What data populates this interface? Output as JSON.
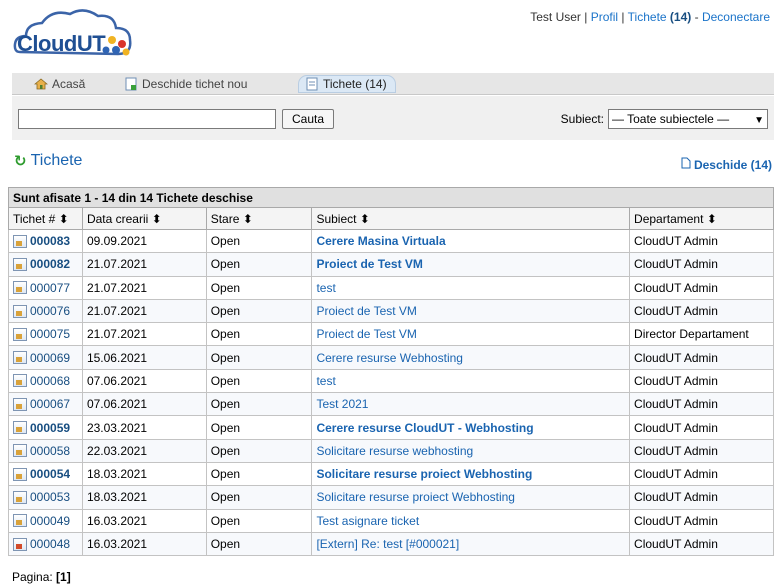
{
  "header": {
    "logo_text": "CloudUT",
    "user": "Test User",
    "profile_link": "Profil",
    "tickets_link": "Tichete",
    "tickets_count": "(14)",
    "logout_link": "Deconectare",
    "separator": "|",
    "dash": "-"
  },
  "nav": {
    "home": "Acasă",
    "new_ticket": "Deschide tichet nou",
    "tickets": "Tichete (14)"
  },
  "search": {
    "value": "",
    "button": "Cauta",
    "subject_label": "Subiect:",
    "subject_selected": "— Toate subiectele —"
  },
  "main": {
    "title": "Tichete",
    "open_link": "Deschide (14)",
    "caption": "Sunt afisate 1 - 14 din 14 Tichete deschise",
    "columns": [
      "Tichet # ⬍",
      "Data crearii ⬍",
      "Stare ⬍",
      "Subiect ⬍",
      "Departament ⬍"
    ],
    "rows": [
      {
        "num": "000083",
        "date": "09.09.2021",
        "state": "Open",
        "subject": "Cerere Masina Virtuala",
        "dept": "CloudUT Admin",
        "bold": true,
        "icon": "ticket"
      },
      {
        "num": "000082",
        "date": "21.07.2021",
        "state": "Open",
        "subject": "Proiect de Test VM",
        "dept": "CloudUT Admin",
        "bold": true,
        "icon": "ticket"
      },
      {
        "num": "000077",
        "date": "21.07.2021",
        "state": "Open",
        "subject": "test",
        "dept": "CloudUT Admin",
        "bold": false,
        "icon": "ticket"
      },
      {
        "num": "000076",
        "date": "21.07.2021",
        "state": "Open",
        "subject": "Proiect de Test VM",
        "dept": "CloudUT Admin",
        "bold": false,
        "icon": "ticket"
      },
      {
        "num": "000075",
        "date": "21.07.2021",
        "state": "Open",
        "subject": "Proiect de Test VM",
        "dept": "Director Departament",
        "bold": false,
        "icon": "ticket"
      },
      {
        "num": "000069",
        "date": "15.06.2021",
        "state": "Open",
        "subject": "Cerere resurse Webhosting",
        "dept": "CloudUT Admin",
        "bold": false,
        "icon": "ticket"
      },
      {
        "num": "000068",
        "date": "07.06.2021",
        "state": "Open",
        "subject": "test",
        "dept": "CloudUT Admin",
        "bold": false,
        "icon": "ticket"
      },
      {
        "num": "000067",
        "date": "07.06.2021",
        "state": "Open",
        "subject": "Test 2021",
        "dept": "CloudUT Admin",
        "bold": false,
        "icon": "ticket"
      },
      {
        "num": "000059",
        "date": "23.03.2021",
        "state": "Open",
        "subject": "Cerere resurse CloudUT - Webhosting",
        "dept": "CloudUT Admin",
        "bold": true,
        "icon": "ticket"
      },
      {
        "num": "000058",
        "date": "22.03.2021",
        "state": "Open",
        "subject": "Solicitare resurse webhosting",
        "dept": "CloudUT Admin",
        "bold": false,
        "icon": "ticket"
      },
      {
        "num": "000054",
        "date": "18.03.2021",
        "state": "Open",
        "subject": "Solicitare resurse proiect Webhosting",
        "dept": "CloudUT Admin",
        "bold": true,
        "icon": "ticket"
      },
      {
        "num": "000053",
        "date": "18.03.2021",
        "state": "Open",
        "subject": "Solicitare resurse proiect Webhosting",
        "dept": "CloudUT Admin",
        "bold": false,
        "icon": "ticket"
      },
      {
        "num": "000049",
        "date": "16.03.2021",
        "state": "Open",
        "subject": "Test asignare ticket",
        "dept": "CloudUT Admin",
        "bold": false,
        "icon": "ticket"
      },
      {
        "num": "000048",
        "date": "16.03.2021",
        "state": "Open",
        "subject": "[Extern] Re: test [#000021]",
        "dept": "CloudUT Admin",
        "bold": false,
        "icon": "ticket-external"
      }
    ]
  },
  "pager": {
    "label": "Pagina:",
    "current": "[1]"
  },
  "colors": {
    "link": "#1a64b0",
    "nav_bg": "#e6e6e6",
    "active_tab": "#dbe8f5",
    "refresh": "#2e9b2e"
  }
}
